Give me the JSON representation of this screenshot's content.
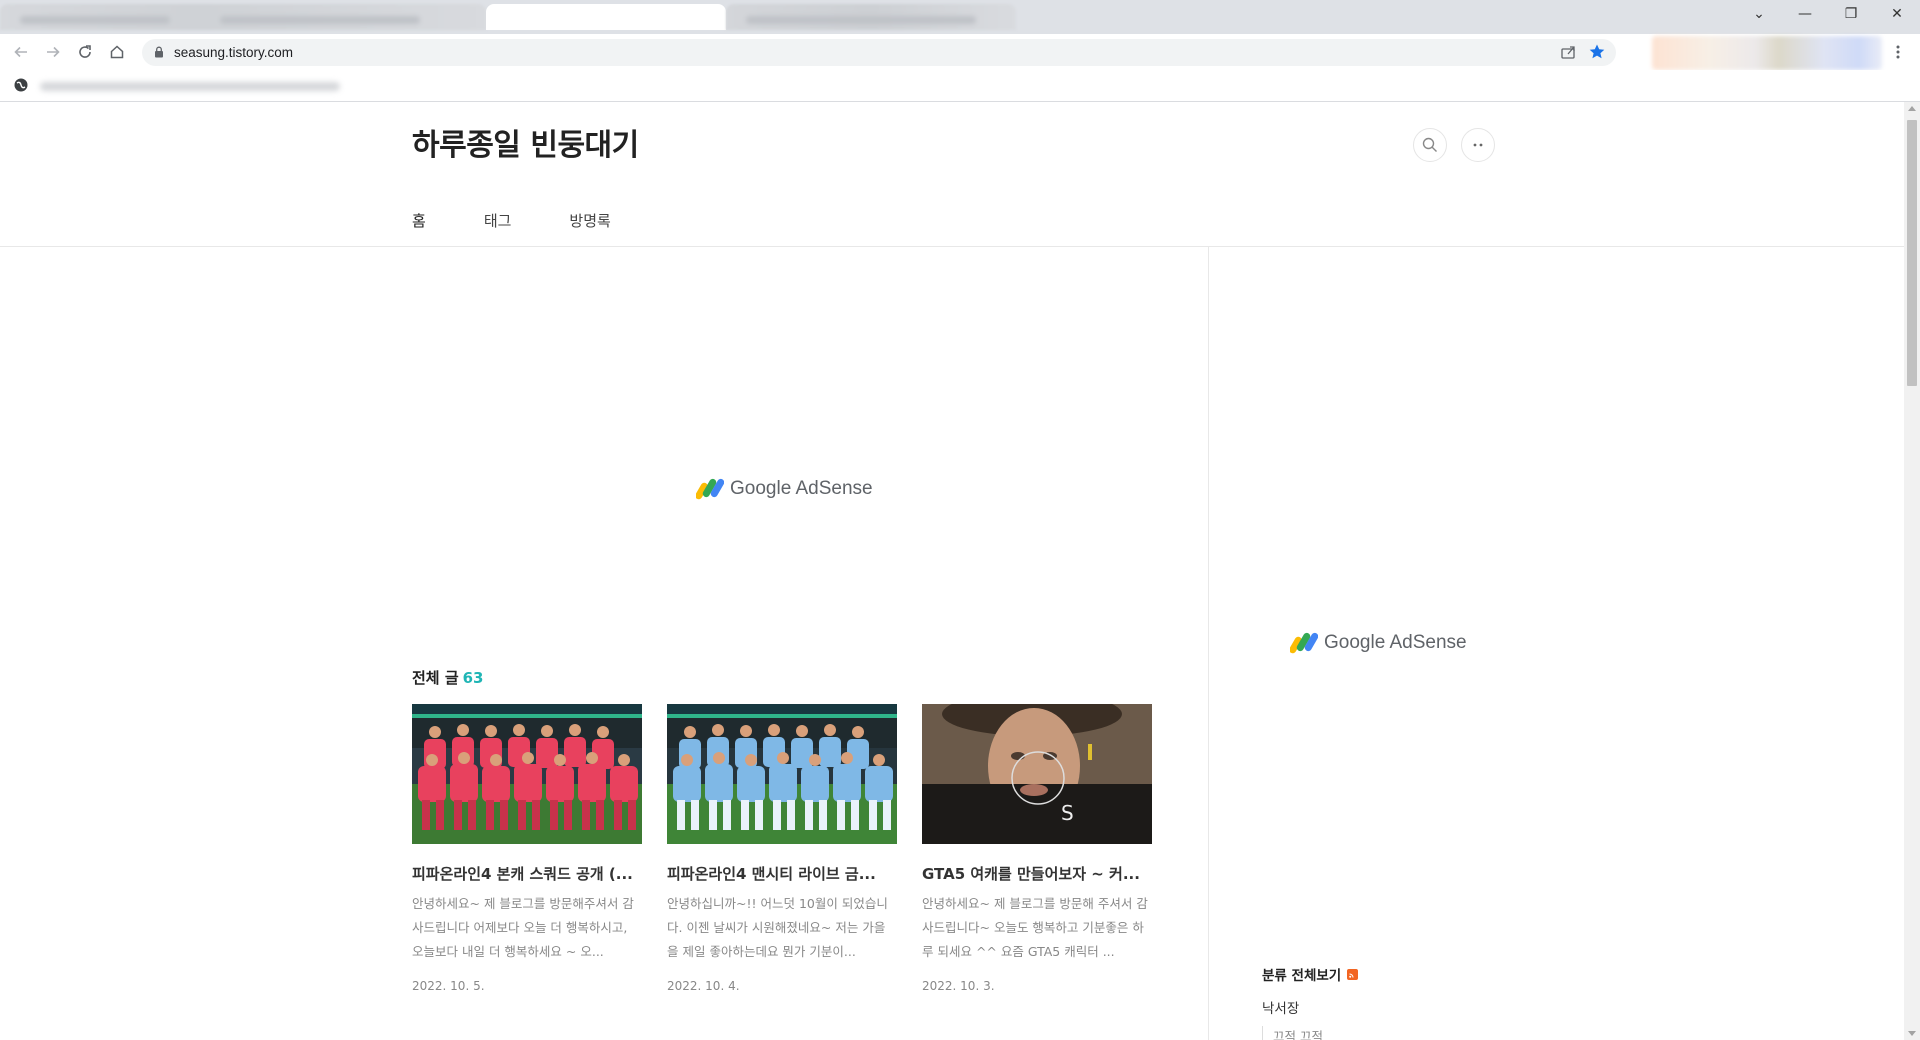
{
  "browser": {
    "url": "seasung.tistory.com",
    "window_controls": {
      "tab_search": "⌄",
      "minimize": "—",
      "restore": "❐",
      "close": "✕"
    }
  },
  "blog": {
    "title": "하루종일 빈둥대기",
    "menu": [
      "홈",
      "태그",
      "방명록"
    ]
  },
  "ads": {
    "main_label": "Google AdSense",
    "side_label": "Google AdSense"
  },
  "posts_section": {
    "label": "전체 글",
    "count": "63"
  },
  "posts": [
    {
      "title": "피파온라인4 본캐 스쿼드 공개 (...",
      "excerpt": "안녕하세요~ 제 블로그를 방문해주셔서 감사드립니다 어제보다 오늘 더 행복하시고, 오늘보다 내일 더 행복하세요 ~ 오...",
      "date": "2022. 10. 5.",
      "thumb": "red-kit-team-photo"
    },
    {
      "title": "피파온라인4 맨시티 라이브 금...",
      "excerpt": "안녕하십니까~!! 어느덧 10월이 되었습니다. 이젠 날씨가 시원해졌네요~ 저는 가을을 제일 좋아하는데요 뭔가 기분이...",
      "date": "2022. 10. 4.",
      "thumb": "sky-blue-kit-team-photo"
    },
    {
      "title": "GTA5 여캐를 만들어보자 ~ 커...",
      "excerpt": "안녕하세요~ 제 블로그를 방문해 주셔서 감사드립니다~ 오늘도 행복하고 기분좋은 하루 되세요 ^^ 요즘 GTA5 캐릭터 ...",
      "date": "2022. 10. 3.",
      "thumb": "character-portrait",
      "thumb_overlay_letter": "S"
    }
  ],
  "sidebar": {
    "category_header": "분류 전체보기",
    "categories": [
      "낙서장"
    ],
    "subcategories": [
      "끄적 끄적"
    ]
  },
  "colors": {
    "accent": "#1fb5b5",
    "rss": "#f26522",
    "star": "#1a73e8"
  }
}
